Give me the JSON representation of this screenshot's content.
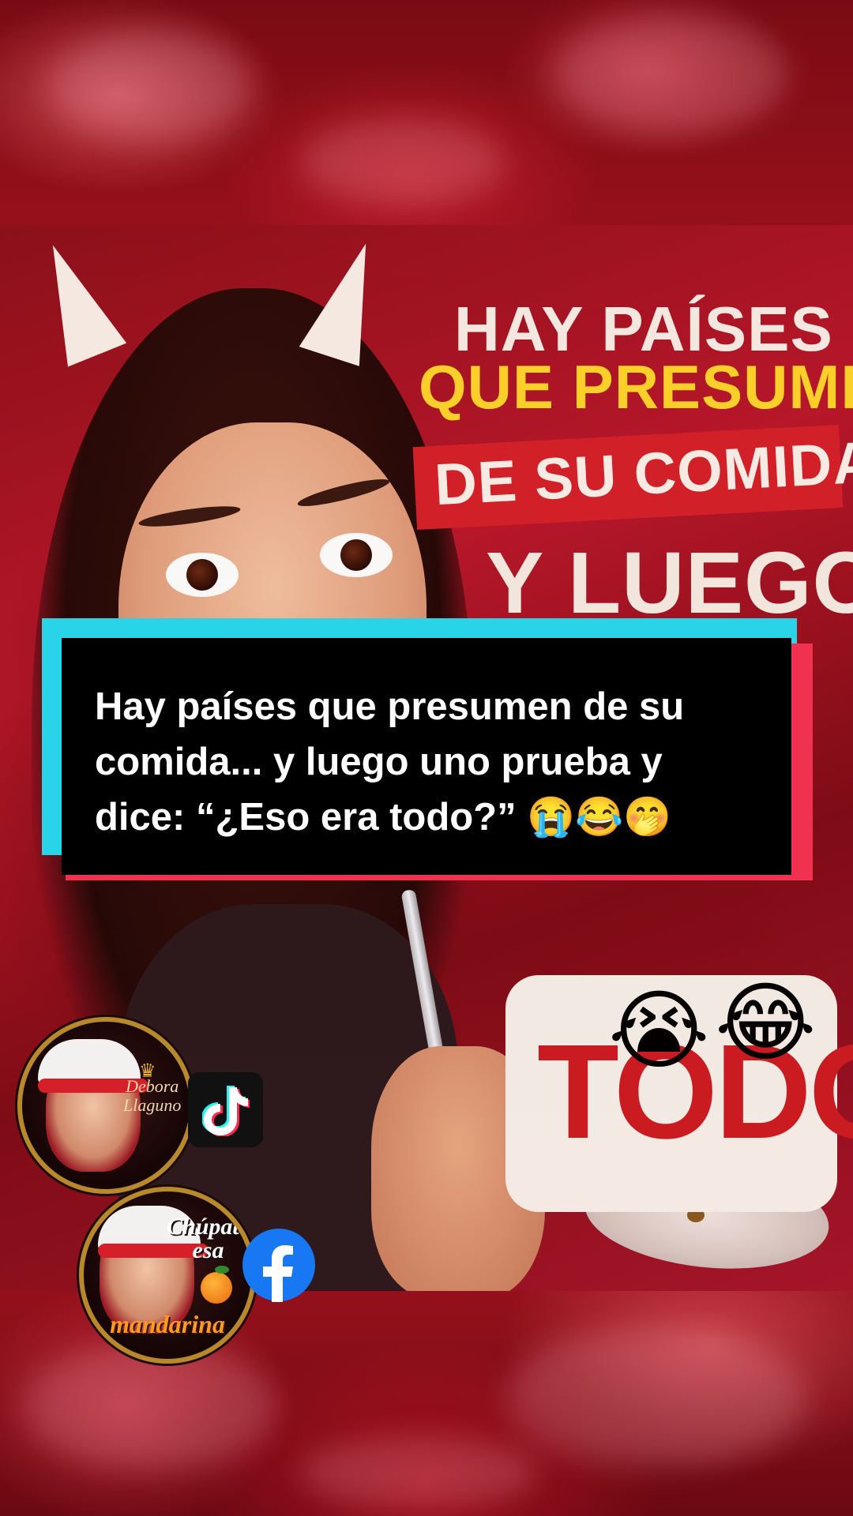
{
  "poster": {
    "line1": "HAY PAÍSES",
    "line2": "QUE PRESUMEN",
    "line3": "DE SU COMIDA...",
    "line4": "Y LUEGO",
    "line5": "TODO?",
    "emoji1": "😭",
    "emoji2": "😂"
  },
  "caption": {
    "text": "Hay países que presumen de su comida... y luego uno prueba y dice: “¿Eso era todo?” 😭😂🤭"
  },
  "badges": {
    "profile1": {
      "name_line1": "Debora",
      "name_line2": "Llaguno",
      "platform_icon": "tiktok-icon"
    },
    "profile2": {
      "brand_line1": "Chúpate",
      "brand_line2": "esa",
      "brand_line3": "mandarina",
      "platform_icon": "facebook-icon"
    }
  },
  "colors": {
    "caption_bg": "#000000",
    "caption_shadow_cyan": "#29d4e9",
    "caption_shadow_red": "#f0314f",
    "poster_yellow": "#ffd62b",
    "poster_red": "#cc1c22",
    "facebook_blue": "#1877f2"
  }
}
